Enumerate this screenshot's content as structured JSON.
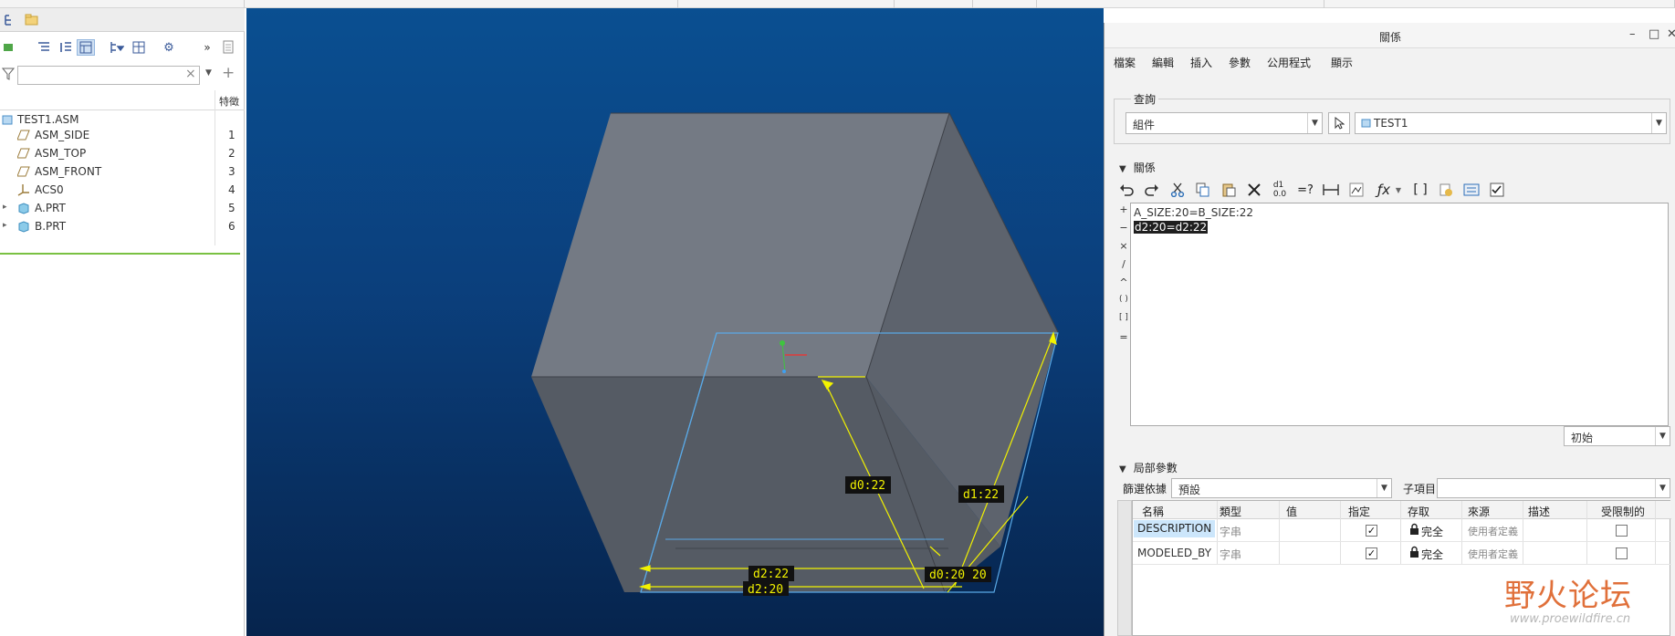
{
  "top_tabs": [
    "Tabstrip-1",
    "Tabstrip-2",
    "Tabstrip-3",
    "Tabstrip-4",
    "Tabstrip-5",
    "Tabstrip-6",
    "Tabstrip-7"
  ],
  "model_tree": {
    "column_header": "特徵",
    "filter_placeholder": "",
    "items": [
      {
        "label": "TEST1.ASM",
        "num": "",
        "icon": "assembly-icon"
      },
      {
        "label": "ASM_SIDE",
        "num": "1",
        "icon": "datum-plane-icon"
      },
      {
        "label": "ASM_TOP",
        "num": "2",
        "icon": "datum-plane-icon"
      },
      {
        "label": "ASM_FRONT",
        "num": "3",
        "icon": "datum-plane-icon"
      },
      {
        "label": "ACS0",
        "num": "4",
        "icon": "coordinate-system-icon"
      },
      {
        "label": "A.PRT",
        "num": "5",
        "icon": "part-icon"
      },
      {
        "label": "B.PRT",
        "num": "6",
        "icon": "part-icon"
      }
    ]
  },
  "viewport": {
    "dimensions": [
      "d0:22",
      "d1:22",
      "d2:22",
      "d2:20",
      "d0:20",
      "20"
    ]
  },
  "relations_dialog": {
    "title": "關係",
    "window_controls": [
      "–",
      "□",
      "✕"
    ],
    "menu": [
      "檔案",
      "編輯",
      "插入",
      "參數",
      "公用程式",
      "顯示"
    ],
    "lookup": {
      "title": "查詢",
      "type_value": "組件",
      "object_value": "TEST1"
    },
    "relations_section": {
      "title": "關係",
      "lines": [
        "A_SIZE:20=B_SIZE:22",
        "d2:20=d2:22"
      ],
      "operators": [
        "+",
        "−",
        "×",
        "/",
        "^",
        "( )",
        "[ ]",
        "="
      ],
      "initial_value": "初始"
    },
    "local_params": {
      "title": "局部參數",
      "filter_label": "篩選依據",
      "filter_value": "預設",
      "subitem_label": "子項目",
      "subitem_value": "",
      "columns": [
        "名稱",
        "類型",
        "值",
        "指定",
        "存取",
        "來源",
        "描述",
        "受限制的"
      ],
      "rows": [
        {
          "name": "DESCRIPTION",
          "type": "字串",
          "value": "",
          "designated": true,
          "access": "完全",
          "source": "使用者定義",
          "description": "",
          "restricted": false
        },
        {
          "name": "MODELED_BY",
          "type": "字串",
          "value": "",
          "designated": true,
          "access": "完全",
          "source": "使用者定義",
          "description": "",
          "restricted": false
        }
      ]
    }
  },
  "watermark": {
    "text": "野火论坛",
    "site": "www.proewildfire.cn"
  },
  "colors": {
    "viewport_top": "#0a4f91",
    "viewport_bottom": "#06244d",
    "dimension": "#f2f200",
    "selection_edge": "#5aa9e6",
    "watermark": "#e0703a"
  }
}
